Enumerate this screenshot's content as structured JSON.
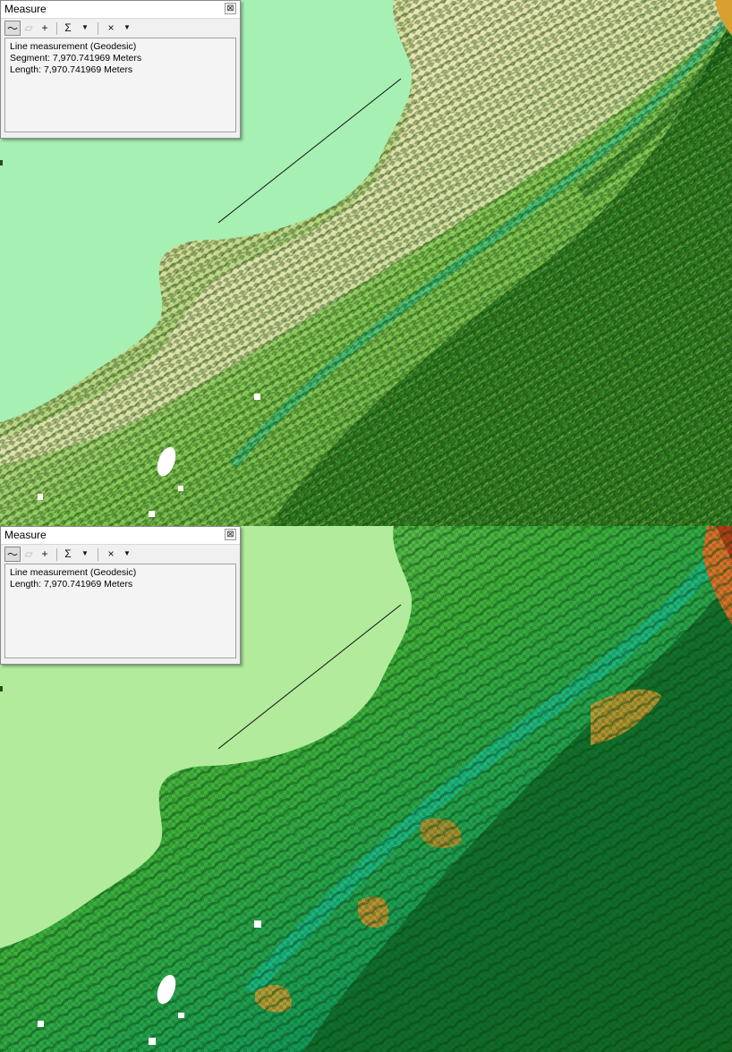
{
  "panels": [
    {
      "window": {
        "title": "Measure",
        "close_glyph": "⊠",
        "toolbar": {
          "measure_line_icon": "〜",
          "measure_area_icon": "▱",
          "measure_feature_icon": "+",
          "sum_icon": "Σ",
          "clear_icon": "×",
          "dropdown_glyph": "▼"
        },
        "lines": [
          "Line measurement (Geodesic)",
          "Segment: 7,970.741969 Meters",
          "Length: 7,970.741969 Meters"
        ]
      }
    },
    {
      "window": {
        "title": "Measure",
        "close_glyph": "⊠",
        "toolbar": {
          "measure_line_icon": "〜",
          "measure_area_icon": "▱",
          "measure_feature_icon": "+",
          "sum_icon": "Σ",
          "clear_icon": "×",
          "dropdown_glyph": "▼"
        },
        "lines": [
          "Line measurement (Geodesic)",
          "Length: 7,970.741969 Meters"
        ]
      }
    }
  ],
  "colors": {
    "sea": "#a6f0b4",
    "sea_bottom": "#b2eb9c",
    "lowland": "#2f7a1e",
    "upland_pale": "#e7e2b0",
    "ridge_teal": "#00b08a",
    "peak_orange": "#e38a2a",
    "peak_red": "#c0401a"
  }
}
